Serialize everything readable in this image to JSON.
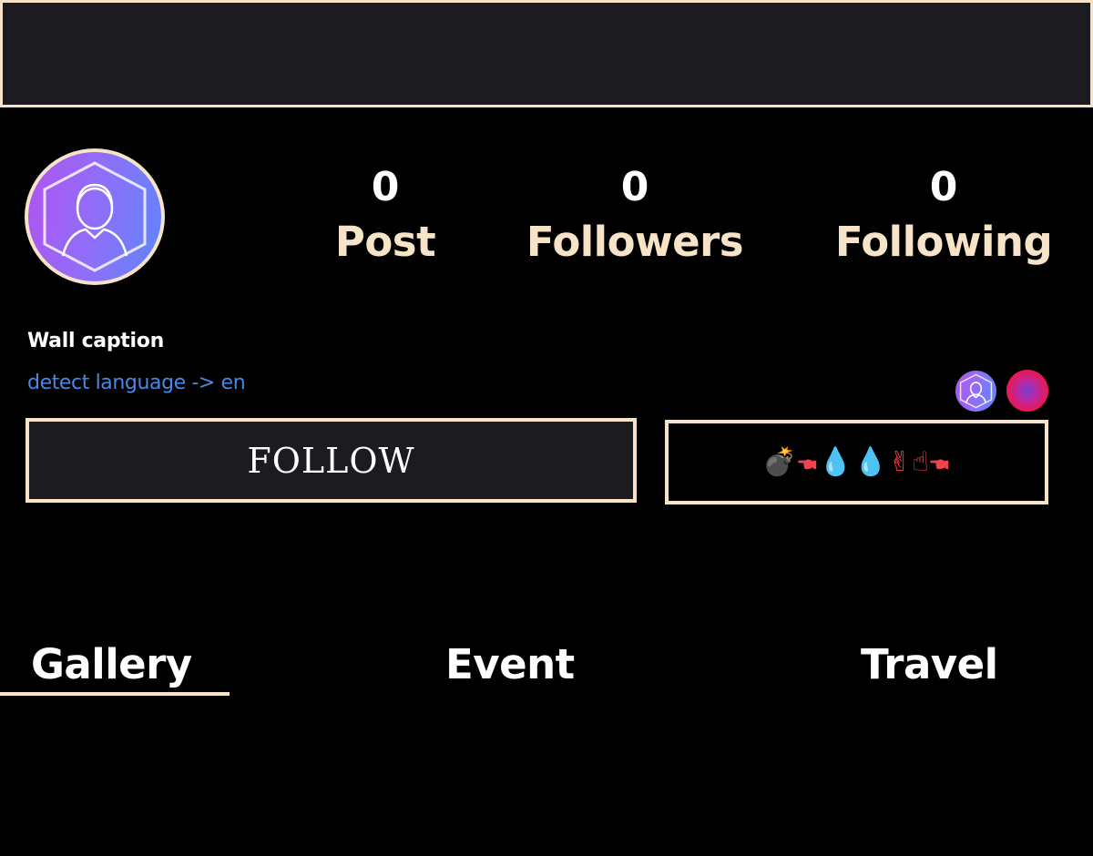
{
  "profile": {
    "stats": [
      {
        "value": "0",
        "label": "Post"
      },
      {
        "value": "0",
        "label": "Followers"
      },
      {
        "value": "0",
        "label": "Following"
      }
    ],
    "caption": "Wall caption",
    "translate_link": "detect language -> en",
    "follow_label": "FOLLOW",
    "emoji_text": "💣🖜💧💧✌☝🖜"
  },
  "tabs": [
    {
      "label": "Gallery",
      "active": true
    },
    {
      "label": "Event",
      "active": false
    },
    {
      "label": "Travel",
      "active": false
    }
  ],
  "colors": {
    "accent": "#f6e3c8",
    "background": "#000000",
    "panel": "#1c1c20",
    "link": "#4a88e6",
    "emoji": "#f0444c",
    "avatar_gradient": [
      "#b054f0",
      "#5f86fb"
    ]
  },
  "icons": {
    "avatar": "user-hexagon-icon",
    "mini_avatar": "user-hexagon-icon",
    "mini_dot": "gradient-dot-icon"
  }
}
